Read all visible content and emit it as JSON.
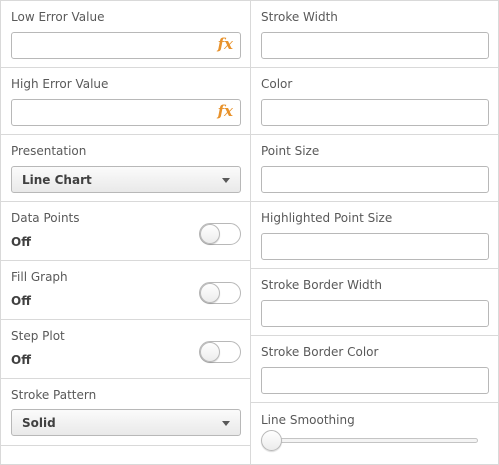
{
  "left": {
    "low_error": {
      "label": "Low Error Value",
      "value": "",
      "fx_icon": "fx"
    },
    "high_error": {
      "label": "High Error Value",
      "value": "",
      "fx_icon": "fx"
    },
    "presentation": {
      "label": "Presentation",
      "selected": "Line Chart"
    },
    "data_points": {
      "label": "Data Points",
      "state": "Off",
      "on": false
    },
    "fill_graph": {
      "label": "Fill Graph",
      "state": "Off",
      "on": false
    },
    "step_plot": {
      "label": "Step Plot",
      "state": "Off",
      "on": false
    },
    "stroke_pattern": {
      "label": "Stroke Pattern",
      "selected": "Solid"
    }
  },
  "right": {
    "stroke_width": {
      "label": "Stroke Width",
      "value": ""
    },
    "color": {
      "label": "Color",
      "value": ""
    },
    "point_size": {
      "label": "Point Size",
      "value": ""
    },
    "highlighted_point_size": {
      "label": "Highlighted Point Size",
      "value": ""
    },
    "stroke_border_width": {
      "label": "Stroke Border Width",
      "value": ""
    },
    "stroke_border_color": {
      "label": "Stroke Border Color",
      "value": ""
    },
    "line_smoothing": {
      "label": "Line Smoothing",
      "value": 0
    }
  },
  "colors": {
    "fx_accent": "#e8922b",
    "border": "#d9d9d9",
    "label": "#595959"
  }
}
